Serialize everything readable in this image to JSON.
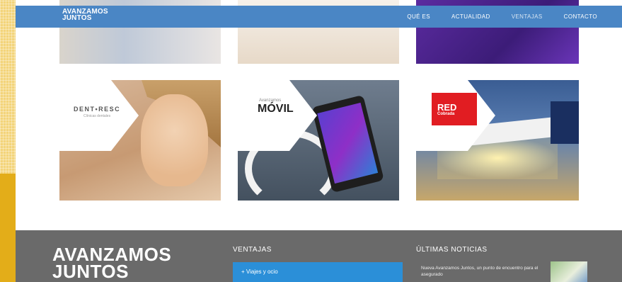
{
  "header": {
    "logo_line1": "AVANZAMOS",
    "logo_line2": "JUNTOS",
    "nav": [
      {
        "label": "QUÉ ES"
      },
      {
        "label": "ACTUALIDAD"
      },
      {
        "label": "VENTAJAS"
      },
      {
        "label": "CONTACTO"
      }
    ],
    "active_nav": "VENTAJAS"
  },
  "cards": {
    "dent": {
      "brand": "DENT•RESC",
      "sub": "Clínicas dentales"
    },
    "movil": {
      "brand": "MÓVIL",
      "sup": "Avanzamos"
    },
    "red": {
      "line1": "RED",
      "line2": "Cobrada"
    }
  },
  "footer": {
    "logo_line1": "AVANZAMOS",
    "logo_line2": "JUNTOS",
    "ventajas_heading": "VENTAJAS",
    "ventajas_item": "+ Viajes y ocio",
    "news_heading": "ÚLTIMAS NOTICIAS",
    "news_text": "Nueva Avanzamos Juntos, un punto de encuentro para el asegurado"
  },
  "colors": {
    "nav_bar": "#4a86c5",
    "footer_bg": "#6a6a6a",
    "accordion": "#2b8fd8",
    "red_brand": "#e11d22",
    "page_border": "#e3ad19"
  }
}
